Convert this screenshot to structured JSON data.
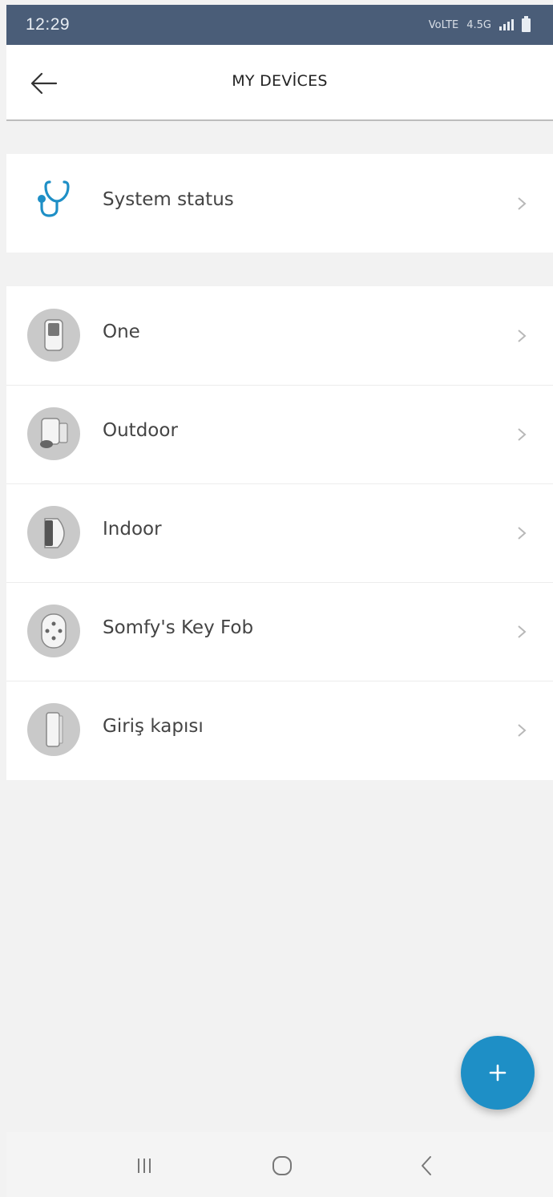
{
  "status_bar": {
    "time": "12:29",
    "network_label": "VoLTE",
    "data_label": "4.5G",
    "signal_icon": "signal-bars-icon",
    "battery_icon": "battery-icon"
  },
  "header": {
    "title": "MY DEVİCES",
    "back_icon": "back-arrow-icon"
  },
  "system_section": {
    "items": [
      {
        "label": "System status",
        "icon": "stethoscope-icon"
      }
    ]
  },
  "devices_section": {
    "items": [
      {
        "label": "One",
        "icon": "camera-device-icon"
      },
      {
        "label": "Outdoor",
        "icon": "outdoor-camera-icon"
      },
      {
        "label": "Indoor",
        "icon": "indoor-camera-icon"
      },
      {
        "label": "Somfy's Key Fob",
        "icon": "key-fob-icon"
      },
      {
        "label": "Giriş kapısı",
        "icon": "door-sensor-icon"
      }
    ]
  },
  "fab": {
    "icon": "plus-icon"
  },
  "nav_bar": {
    "recents_icon": "recents-icon",
    "home_icon": "home-icon",
    "back_icon": "nav-back-icon"
  },
  "colors": {
    "status_bar": "#4a5d78",
    "accent": "#1e8fc6",
    "stethoscope": "#1e8fc6",
    "icon_circle": "#c9c9c9",
    "background": "#f2f2f2"
  }
}
